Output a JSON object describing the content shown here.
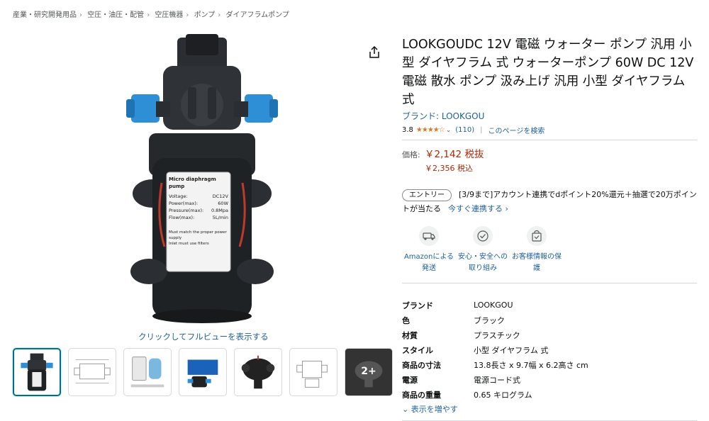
{
  "breadcrumb": [
    "産業・研究開発用品",
    "空圧・油圧・配管",
    "空圧機器",
    "ポンプ",
    "ダイアフラムポンプ"
  ],
  "product": {
    "title": "LOOKGOUDC 12V 電磁 ウォーター ポンプ 汎用 小型 ダイヤフラム 式 ウォーターポンプ 60W DC 12V 電磁 散水 ポンプ 汲み上げ 汎用 小型 ダイヤフラム 式",
    "brand_link": "ブランド: LOOKGOU",
    "rating": "3.8",
    "stars": "★★★★☆",
    "review_count": "(110)",
    "search_page": "このページを検索"
  },
  "price": {
    "label": "価格:",
    "value": "￥2,142 税抜",
    "incl_tax": "￥2,356 税込"
  },
  "promo": {
    "badge": "エントリー",
    "text": "[3/9まで]アカウント連携でdポイント20%還元＋抽選で20万ポイントが当たる",
    "link": "今すぐ連携する ›"
  },
  "features": [
    {
      "label": "Amazonによる発送",
      "icon": "truck-icon"
    },
    {
      "label": "安心・安全への取り組み",
      "icon": "badge-check-icon"
    },
    {
      "label": "お客様情報の保護",
      "icon": "secure-bag-icon"
    }
  ],
  "specs": [
    {
      "key": "ブランド",
      "value": "LOOKGOU"
    },
    {
      "key": "色",
      "value": "ブラック"
    },
    {
      "key": "材質",
      "value": "プラスチック"
    },
    {
      "key": "スタイル",
      "value": "小型 ダイヤフラム 式"
    },
    {
      "key": "商品の寸法",
      "value": "13.8長さ x 9.7幅 x 6.2高さ cm"
    },
    {
      "key": "電源",
      "value": "電源コード式"
    },
    {
      "key": "商品の重量",
      "value": "0.65 キログラム"
    }
  ],
  "show_more": "表示を増やす",
  "gallery": {
    "fullview": "クリックしてフルビューを表示する",
    "more_label": "2+",
    "label_lines": [
      "Micro diaphragm pump",
      "Voltage:",
      "DC12V",
      "Power(max):",
      "60W",
      "Pressure(max):",
      "0.8Mpa",
      "Flow(max):",
      "5L/min",
      "Must match the proper power supply",
      "Inlet must use filters"
    ]
  },
  "colors": {
    "link": "#2162a1",
    "price": "#b12704",
    "star": "#de7921",
    "accent_border": "#007185"
  }
}
